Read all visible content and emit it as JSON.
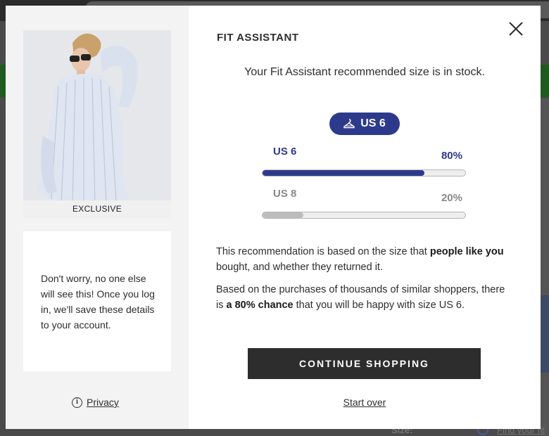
{
  "modal": {
    "title": "FIT ASSISTANT",
    "subtitle": "Your Fit Assistant recommended size is in stock.",
    "recommended_size": "US 6",
    "close_icon": "close-icon",
    "product": {
      "badge": "EXCLUSIVE",
      "image_icon": "product-photo"
    },
    "info_text": "Don't worry, no one else will see this! Once you log in, we'll save these details to your account.",
    "privacy_label": "Privacy",
    "sizes": [
      {
        "label": "US 6",
        "percent_label": "80%",
        "percent": 80,
        "color": "#2d3a8c"
      },
      {
        "label": "US 8",
        "percent_label": "20%",
        "percent": 20,
        "color": "#bdbdbd"
      }
    ],
    "explain1": {
      "pre": "This recommendation is based on the size that ",
      "bold": "people like you",
      "post": " bought, and whether they returned it."
    },
    "explain2": {
      "pre": "Based on the purchases of thousands of similar shoppers, there is ",
      "bold": "a 80% chance",
      "post": " that you will be happy with size US 6."
    },
    "continue_label": "CONTINUE SHOPPING",
    "start_over_label": "Start over"
  },
  "background": {
    "size_label": "Size:",
    "fit_link": "Find your fit"
  },
  "colors": {
    "accent": "#2d3a8c",
    "dark": "#2d2d2d",
    "muted": "#888888"
  }
}
